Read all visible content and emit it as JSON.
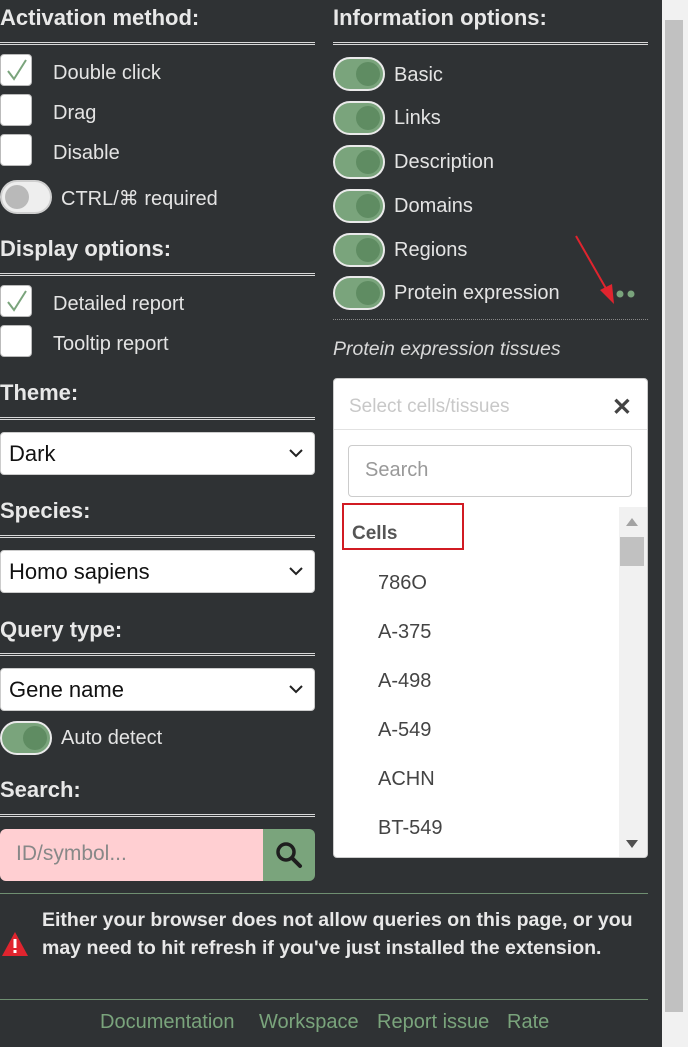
{
  "activation": {
    "heading": "Activation method:",
    "options": [
      {
        "label": "Double click",
        "checked": true
      },
      {
        "label": "Drag",
        "checked": false
      },
      {
        "label": "Disable",
        "checked": false
      }
    ],
    "ctrl_label": "CTRL/⌘ required"
  },
  "display": {
    "heading": "Display options:",
    "options": [
      {
        "label": "Detailed report",
        "checked": true
      },
      {
        "label": "Tooltip report",
        "checked": false
      }
    ]
  },
  "theme": {
    "heading": "Theme:",
    "selected": "Dark"
  },
  "species": {
    "heading": "Species:",
    "selected": "Homo sapiens"
  },
  "query": {
    "heading": "Query type:",
    "selected": "Gene name",
    "auto_detect": "Auto detect"
  },
  "search": {
    "heading": "Search:",
    "placeholder": "ID/symbol..."
  },
  "info": {
    "heading": "Information options:",
    "options": [
      "Basic",
      "Links",
      "Description",
      "Domains",
      "Regions",
      "Protein expression"
    ]
  },
  "tissues": {
    "label": "Protein expression tissues",
    "placeholder": "Select cells/tissues",
    "search_placeholder": "Search",
    "group": "Cells",
    "items": [
      "786O",
      "A-375",
      "A-498",
      "A-549",
      "ACHN",
      "BT-549"
    ]
  },
  "notice": "Either your browser does not allow queries on this page, or you may need to hit refresh if you've just installed the extension.",
  "footer": {
    "links": [
      "Documentation",
      "Workspace",
      "Report issue",
      "Rate"
    ]
  },
  "colors": {
    "accent": "#7aa47c",
    "background": "#2f3234",
    "highlight": "#d11b23",
    "warning": "#e0242e"
  }
}
